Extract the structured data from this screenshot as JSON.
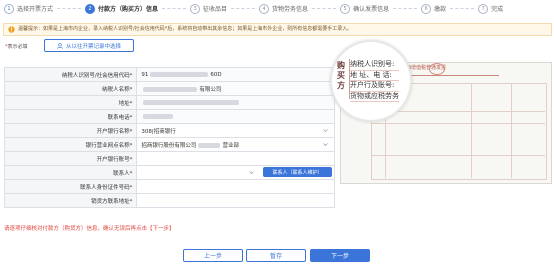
{
  "steps": [
    {
      "num": "1",
      "label": "选择开票方式"
    },
    {
      "num": "2",
      "label": "付款方（购买方）信息"
    },
    {
      "num": "3",
      "label": "征收品目"
    },
    {
      "num": "4",
      "label": "货物劳务信息"
    },
    {
      "num": "5",
      "label": "确认发票信息"
    },
    {
      "num": "6",
      "label": "缴款"
    },
    {
      "num": "7",
      "label": "完成"
    }
  ],
  "notice": "温馨提示：如果是上海市内企业，录入纳税人识别号/社会信用代码*后，系统将自动带出其余信息；如果是上海市外企业，则所有信息都需要手工录入。",
  "required_note": {
    "star": "*",
    "text": "表示必填"
  },
  "pick_button": "从以往开票记录中选择",
  "form": {
    "rows": [
      {
        "label": "纳税人识别号/社会信用代码*",
        "prefix": "91",
        "suffix": "60D"
      },
      {
        "label": "纳税人名称*",
        "suffix": "有限公司"
      },
      {
        "label": "地址*"
      },
      {
        "label": "联系电话*"
      },
      {
        "label": "开户银行名称*",
        "value": "308|招商银行"
      },
      {
        "label": "银行营业网点名称*",
        "value": "招商银行股份有限公司",
        "suffix": "营业部"
      },
      {
        "label": "开户银行账号*"
      },
      {
        "label": "联系人*",
        "button": "联系人（联系人维护）"
      },
      {
        "label": "联系人身份证件号码*"
      },
      {
        "label": "销货方联系地址*"
      }
    ]
  },
  "hint": "请逐项仔细核对付款方（购货方）信息，确认无误后再点击【下一步】",
  "invoice": {
    "side_label": "购买方",
    "title": "上海增值税普通发票",
    "mag_lines": [
      "纳税人识别号:",
      "地  址、电  话:",
      "开户行及账号:",
      "货物或应税劳务"
    ]
  },
  "buttons": {
    "prev": "上一步",
    "save": "暂存",
    "next": "下一步"
  }
}
